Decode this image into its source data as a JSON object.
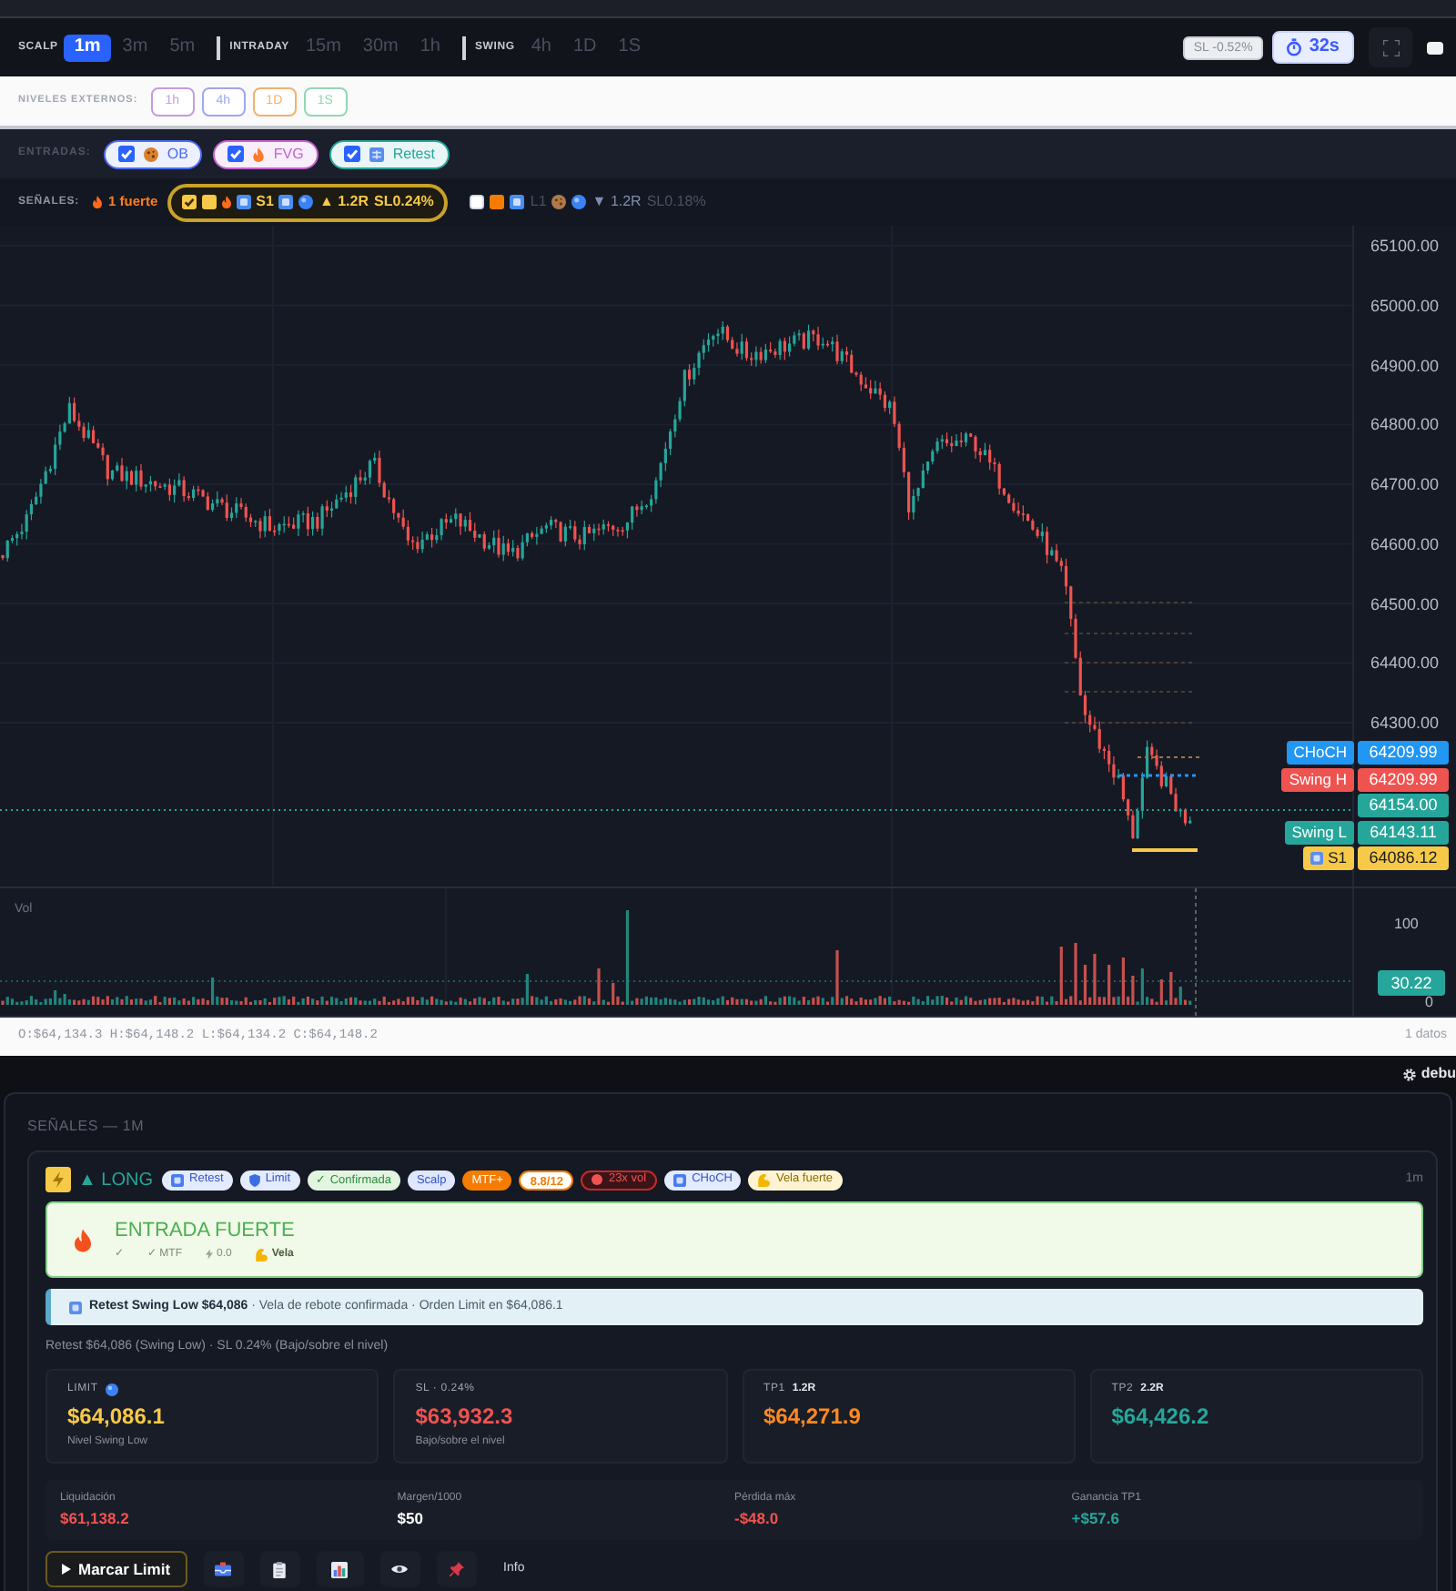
{
  "toolbar": {
    "groups": [
      {
        "label": "SCALP",
        "options": [
          {
            "label": "1m",
            "selected": true
          },
          {
            "label": "3m",
            "selected": false
          },
          {
            "label": "5m",
            "selected": false
          }
        ]
      },
      {
        "label": "INTRADAY",
        "options": [
          {
            "label": "15m",
            "selected": false
          },
          {
            "label": "30m",
            "selected": false
          },
          {
            "label": "1h",
            "selected": false
          }
        ]
      },
      {
        "label": "SWING",
        "options": [
          {
            "label": "4h",
            "selected": false
          },
          {
            "label": "1D",
            "selected": false
          },
          {
            "label": "1S",
            "selected": false
          }
        ]
      }
    ],
    "sl_chip": "SL -0.52%",
    "timer": "32s"
  },
  "external_levels": {
    "label": "NIVELES EXTERNOS:",
    "chips": [
      {
        "label": "1h",
        "color": "#c59be0"
      },
      {
        "label": "4h",
        "color": "#9fa6f2"
      },
      {
        "label": "1D",
        "color": "#f5b06a"
      },
      {
        "label": "1S",
        "color": "#93d6b4"
      }
    ]
  },
  "entries": {
    "label": "ENTRADAS:",
    "toggles": [
      {
        "kind": "ob",
        "label": "OB",
        "checked": true,
        "color": "#4a6cf7"
      },
      {
        "kind": "fvg",
        "label": "FVG",
        "checked": true,
        "color": "#c462d0"
      },
      {
        "kind": "retest",
        "label": "Retest",
        "checked": true,
        "color": "#26a69a"
      }
    ]
  },
  "signals": {
    "label": "SEÑALES:",
    "strong_count": "1 fuerte",
    "sets": [
      {
        "checked": true,
        "strong": true,
        "color": "#f7c948",
        "level": "S1",
        "rr": "▲ 1.2R",
        "sl": "SL0.24%"
      },
      {
        "checked": false,
        "strong": false,
        "color": "#f57c00",
        "level": "L1",
        "rr": "▼ 1.2R",
        "sl": "SL0.18%"
      }
    ]
  },
  "chart": {
    "price_ticks": [
      "65100.00",
      "65000.00",
      "64900.00",
      "64800.00",
      "64700.00",
      "64600.00",
      "64500.00",
      "64400.00",
      "64300.00"
    ],
    "price_labels": [
      {
        "kind": "level",
        "tag": "CHoCH",
        "value": "64209.99",
        "color": "#2196f3"
      },
      {
        "kind": "level",
        "tag": "Swing H",
        "value": "64209.99",
        "color": "#ef5350"
      },
      {
        "kind": "level",
        "value": "64154.00",
        "color": "#26a69a"
      },
      {
        "kind": "level",
        "tag": "Swing L",
        "value": "64143.11",
        "color": "#26a69a"
      },
      {
        "kind": "signal",
        "tag": "S1",
        "value": "64086.12",
        "color": "#f7c948"
      }
    ],
    "volume": {
      "label": "Vol",
      "ticks": [
        "100",
        "0"
      ],
      "reading": "30.22"
    },
    "ohlc": "O:$64,134.3 H:$64,148.2 L:$64,134.2 C:$64,148.2",
    "bar_count": "1 datos"
  },
  "debug": "debu",
  "signal_panel": {
    "title": "SEÑALES — 1M",
    "signal": {
      "direction": "▲ LONG",
      "timeframe": "1m",
      "tags": [
        {
          "kind": "retest",
          "label": "Retest"
        },
        {
          "kind": "limit",
          "label": "Limit"
        },
        {
          "kind": "confirmed",
          "label": "✓ Confirmada"
        },
        {
          "kind": "plain",
          "label": "Scalp"
        },
        {
          "kind": "mtf",
          "label": "MTF+"
        },
        {
          "kind": "score",
          "label": "8.8/12"
        },
        {
          "kind": "volume",
          "label": "23x vol"
        },
        {
          "kind": "choch",
          "label": "CHoCH"
        },
        {
          "kind": "candle",
          "label": "Vela fuerte"
        }
      ]
    },
    "strength": {
      "title": "ENTRADA FUERTE",
      "checks": [
        {
          "kind": "text",
          "label": "✓"
        },
        {
          "kind": "text",
          "label": "✓ MTF"
        },
        {
          "kind": "bolt",
          "label": "0.0"
        },
        {
          "kind": "arm",
          "label": "Vela"
        }
      ]
    },
    "note": "**Retest Swing Low $64,086** · Vela de rebote confirmada · Orden Limit en $64,086.1",
    "summary": "Retest $64,086 (Swing Low) · SL 0.24% (Bajo/sobre el nivel)",
    "levels": [
      {
        "kind": "limit",
        "label": "LIMIT",
        "value": "$64,086.1",
        "note": "Nivel Swing Low",
        "color": "#f7c948"
      },
      {
        "kind": "sl",
        "label": "SL · 0.24%",
        "value": "$63,932.3",
        "note": "Bajo/sobre el nivel",
        "color": "#ef5350"
      },
      {
        "kind": "tp",
        "label": "TP1",
        "tag": "1.2R",
        "value": "$64,271.9",
        "color": "#ff8a1f"
      },
      {
        "kind": "tp",
        "label": "TP2",
        "tag": "2.2R",
        "value": "$64,426.2",
        "color": "#26a69a"
      }
    ],
    "stats": [
      {
        "label": "Liquidación",
        "value": "$61,138.2",
        "color": "#ef5350"
      },
      {
        "label": "Margen/1000",
        "value": "$50",
        "color": "#ffffff"
      },
      {
        "label": "Pérdida máx",
        "value": "-$48.0",
        "color": "#ef5350"
      },
      {
        "label": "Ganancia TP1",
        "value": "+$57.6",
        "color": "#26a69a"
      }
    ],
    "primary_action": "Marcar Limit",
    "info_action": "Info"
  }
}
